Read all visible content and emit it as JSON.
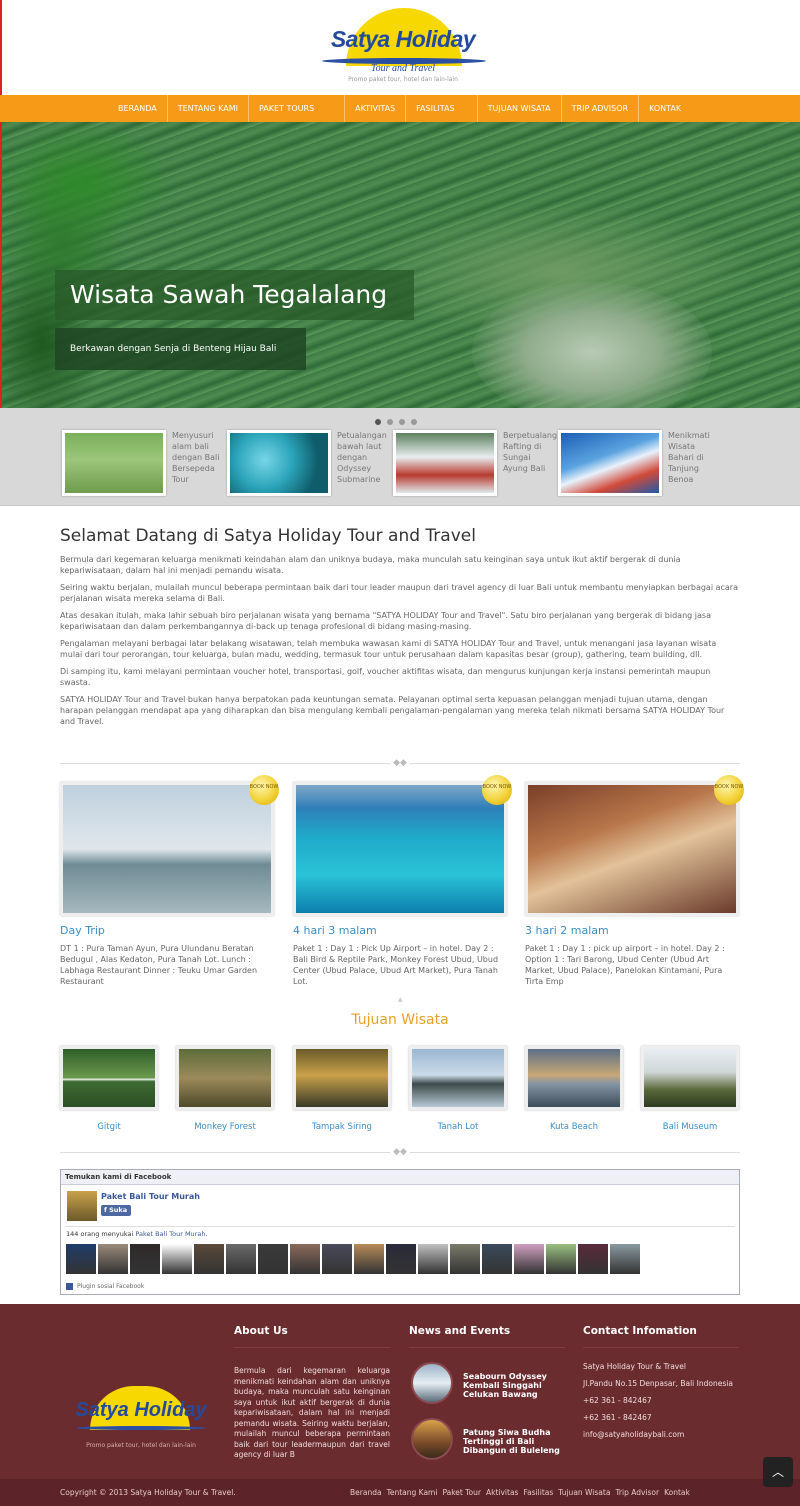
{
  "brand": {
    "name": "Satya Holiday",
    "tagline": "Tour and Travel",
    "promo": "Promo paket tour, hotel dan lain-lain"
  },
  "nav": [
    "BERANDA",
    "TENTANG KAMI",
    "PAKET TOURS",
    "AKTIVITAS",
    "FASILITAS",
    "TUJUAN WISATA",
    "TRIP ADVISOR",
    "KONTAK"
  ],
  "hero": {
    "title": "Wisata Sawah Tegalalang",
    "subtitle": "Berkawan dengan Senja di Benteng Hijau Bali"
  },
  "thumbs": [
    {
      "text": "Menyusuri alam bali dengan Bali Bersepeda Tour"
    },
    {
      "text": "Petualangan bawah laut dengan Odyssey Submarine"
    },
    {
      "text": "Berpetualang Rafting di Sungai Ayung Bali"
    },
    {
      "text": "Menikmati Wisata Bahari di Tanjung Benoa"
    }
  ],
  "intro": {
    "title": "Selamat Datang di Satya Holiday Tour and Travel",
    "paragraphs": [
      "Bermula dari kegemaran keluarga menikmati keindahan alam dan uniknya budaya, maka munculah satu keinginan saya untuk ikut aktif bergerak di dunia kepariwisataan, dalam hal ini menjadi pemandu wisata.",
      "Seiring waktu berjalan, mulailah muncul beberapa permintaan baik dari tour leader maupun dari travel agency di luar Bali untuk membantu menyiapkan berbagai acara perjalanan wisata mereka selama di Bali.",
      "Atas desakan itulah, maka lahir sebuah biro perjalanan wisata yang bernama \"SATYA HOLIDAY Tour and Travel\". Satu biro perjalanan yang bergerak di bidang jasa kepariwisataan dan dalam perkembangannya di-back up tenaga profesional di bidang masing-masing.",
      "Pengalaman melayani berbagai latar belakang wisatawan, telah membuka wawasan kami di SATYA HOLIDAY Tour and Travel, untuk menangani jasa layanan wisata mulai dari tour perorangan, tour keluarga, bulan madu, wedding, termasuk tour untuk perusahaan dalam kapasitas besar (group), gathering, team building, dll.",
      "Di samping itu, kami melayani permintaan voucher hotel, transportasi, golf, voucher aktifitas wisata, dan mengurus kunjungan kerja instansi pemerintah maupun swasta.",
      "SATYA HOLIDAY Tour and Travel bukan hanya berpatokan pada keuntungan semata. Pelayanan optimal serta kepuasan pelanggan menjadi tujuan utama, dengan harapan pelanggan mendapat apa yang diharapkan dan bisa mengulang kembali pengalaman-pengalaman yang mereka telah nikmati bersama SATYA HOLIDAY Tour and Travel."
    ]
  },
  "packages": [
    {
      "badge": "BOOK NOW",
      "title": "Day Trip",
      "desc": "DT 1 : Pura Taman Ayun, Pura Ulundanu Beratan Bedugul , Alas Kedaton, Pura Tanah Lot. Lunch : Labhaga  Restaurant Dinner : Teuku Umar Garden Restaurant"
    },
    {
      "badge": "BOOK NOW",
      "title": "4 hari 3 malam",
      "desc": "Paket 1 : Day 1 : Pick Up Airport – in hotel. Day 2 : Bali Bird & Reptile Park, Monkey Forest Ubud, Ubud Center (Ubud Palace, Ubud Art Market), Pura Tanah Lot."
    },
    {
      "badge": "BOOK NOW",
      "title": "3 hari 2 malam",
      "desc": "Paket 1 : Day 1  : pick up airport – in hotel. Day 2 : Option 1 : Tari Barong, Ubud Center (Ubud Art Market, Ubud Palace), Panelokan Kintamani, Pura Tirta Emp"
    }
  ],
  "tujuan": {
    "title": "Tujuan Wisata",
    "items": [
      "Gitgit",
      "Monkey Forest",
      "Tampak Siring",
      "Tanah Lot",
      "Kuta Beach",
      "Bali Museum"
    ]
  },
  "facebook": {
    "header": "Temukan kami di Facebook",
    "page_name": "Paket Bali Tour Murah",
    "like": "Suka",
    "count_prefix": "144 orang menyukai",
    "count_link": "Paket Bali Tour Murah",
    "plugin": "Plugin sosial Facebook"
  },
  "footer": {
    "about_title": "About Us",
    "about_text": "Bermula dari kegemaran keluarga menikmati keindahan alam dan uniknya budaya, maka munculah satu keinginan saya untuk ikut aktif bergerak di dunia kepariwisataan, dalam hal ini menjadi pemandu wisata. Seiring waktu berjalan, mulailah muncul beberapa permintaan baik dari tour leadermaupun dari travel agency di luar B",
    "news_title": "News and Events",
    "news": [
      "Seabourn Odyssey Kembali Singgahi Celukan Bawang",
      "Patung Siwa Budha Tertinggi di Bali Dibangun di Buleleng"
    ],
    "contact_title": "Contact Infomation",
    "contact": [
      "Satya Holiday Tour & Travel",
      "Jl.Pandu No.15 Denpasar, Bali Indonesia",
      "+62 361 - 842467",
      "+62 361 - 842467",
      "info@satyaholidaybali.com"
    ],
    "copyright": "Copyright © 2013 Satya Holiday Tour & Travel.",
    "links": [
      "Beranda",
      "Tentang Kami",
      "Paket Tour",
      "Aktivitas",
      "Fasilitas",
      "Tujuan Wisata",
      "Trip Advisor",
      "Kontak"
    ]
  },
  "colors": {
    "nav": "#f79a17",
    "accent_link": "#3a8ec8",
    "section_title": "#e8a126",
    "footer": "#6b2c30"
  }
}
